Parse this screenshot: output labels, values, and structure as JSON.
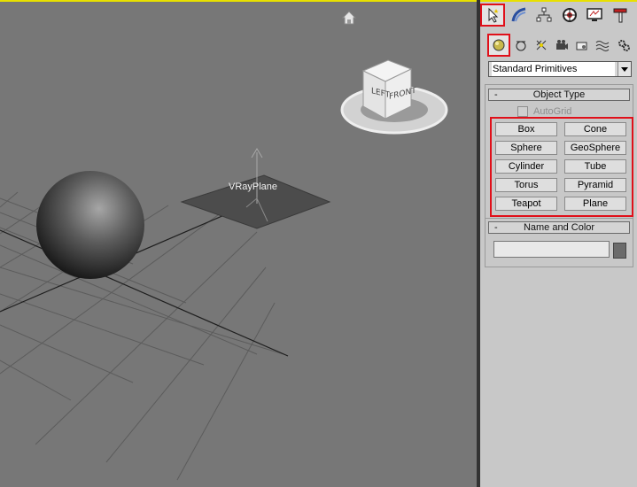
{
  "viewport": {
    "object_label": "VRayPlane",
    "viewcube": {
      "left": "LEFT",
      "front": "FRONT"
    },
    "icons": {
      "home": "home-icon"
    }
  },
  "command_panel": {
    "tabs": [
      {
        "name": "create-tab",
        "icon": "cursor-star-icon",
        "selected": true
      },
      {
        "name": "modify-tab",
        "icon": "modify-bend-icon"
      },
      {
        "name": "hierarchy-tab",
        "icon": "hierarchy-icon"
      },
      {
        "name": "motion-tab",
        "icon": "motion-wheel-icon"
      },
      {
        "name": "display-tab",
        "icon": "display-monitor-icon"
      },
      {
        "name": "utilities-tab",
        "icon": "hammer-icon"
      }
    ],
    "subcategories": [
      {
        "name": "geometry",
        "icon": "sphere-icon",
        "selected": true
      },
      {
        "name": "shapes",
        "icon": "shapes-icon"
      },
      {
        "name": "lights",
        "icon": "light-icon"
      },
      {
        "name": "cameras",
        "icon": "camera-icon"
      },
      {
        "name": "helpers",
        "icon": "helper-icon"
      },
      {
        "name": "space-warps",
        "icon": "wave-icon"
      },
      {
        "name": "systems",
        "icon": "gears-icon"
      }
    ],
    "category_dropdown": "Standard Primitives",
    "object_type": {
      "header": "Object Type",
      "collapse": "-",
      "autogrid": "AutoGrid",
      "buttons": [
        "Box",
        "Cone",
        "Sphere",
        "GeoSphere",
        "Cylinder",
        "Tube",
        "Torus",
        "Pyramid",
        "Teapot",
        "Plane"
      ]
    },
    "name_and_color": {
      "header": "Name and Color",
      "collapse": "-",
      "name_value": "",
      "color": "#6b6b6b"
    }
  },
  "colors": {
    "viewport_bg": "#777777",
    "panel_bg": "#c8c8c8",
    "active_border": "#e8e000",
    "highlight": "#e0101a"
  }
}
